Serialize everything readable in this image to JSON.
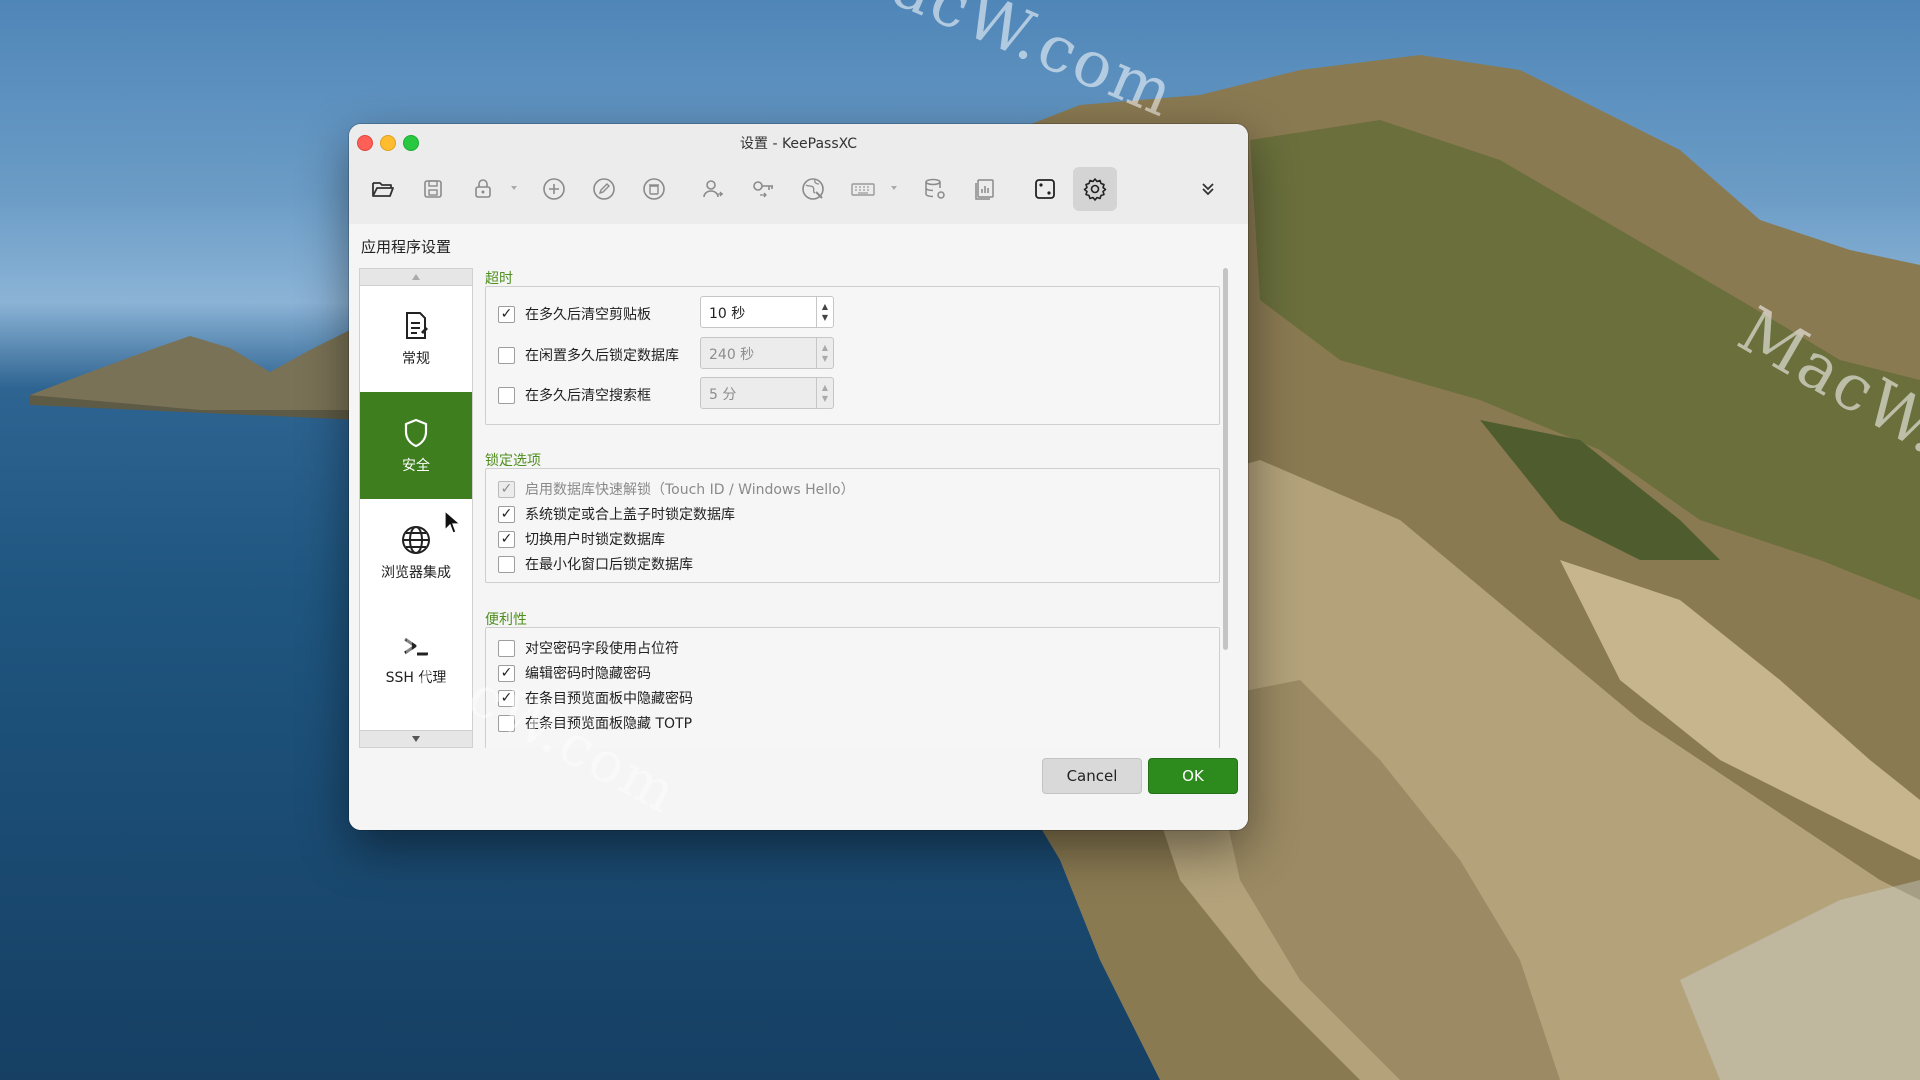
{
  "window": {
    "title": "设置 - KeePassXC"
  },
  "toolbar": {
    "items": [
      {
        "icon": "folder-open-icon"
      },
      {
        "icon": "save-icon"
      },
      {
        "icon": "lock-icon"
      },
      {
        "icon": "add-entry-icon"
      },
      {
        "icon": "edit-entry-icon"
      },
      {
        "icon": "delete-entry-icon"
      },
      {
        "icon": "copy-username-icon"
      },
      {
        "icon": "copy-password-icon"
      },
      {
        "icon": "open-url-icon"
      },
      {
        "icon": "keyboard-autotype-icon"
      },
      {
        "icon": "database-settings-icon"
      },
      {
        "icon": "reports-icon"
      },
      {
        "icon": "password-generator-icon"
      },
      {
        "icon": "settings-gear-icon",
        "active": true
      },
      {
        "icon": "overflow-chevron-icon"
      }
    ]
  },
  "page": {
    "heading": "应用程序设置"
  },
  "sidebar": {
    "items": [
      {
        "label": "常规",
        "icon": "general-document-icon"
      },
      {
        "label": "安全",
        "icon": "shield-icon",
        "active": true
      },
      {
        "label": "浏览器集成",
        "icon": "globe-icon"
      },
      {
        "label": "SSH 代理",
        "icon": "terminal-prompt-icon"
      }
    ]
  },
  "sections": {
    "timeout": {
      "title": "超时",
      "rows": [
        {
          "label": "在多久后清空剪贴板",
          "checked": true,
          "value": "10 秒",
          "enabled": true
        },
        {
          "label": "在闲置多久后锁定数据库",
          "checked": false,
          "value": "240 秒",
          "enabled": false
        },
        {
          "label": "在多久后清空搜索框",
          "checked": false,
          "value": "5 分",
          "enabled": false
        }
      ]
    },
    "lock": {
      "title": "锁定选项",
      "rows": [
        {
          "label": "启用数据库快速解锁（Touch ID / Windows Hello）",
          "checked": true,
          "enabled": false
        },
        {
          "label": "系统锁定或合上盖子时锁定数据库",
          "checked": true,
          "enabled": true
        },
        {
          "label": "切换用户时锁定数据库",
          "checked": true,
          "enabled": true
        },
        {
          "label": "在最小化窗口后锁定数据库",
          "checked": false,
          "enabled": true
        }
      ]
    },
    "convenience": {
      "title": "便利性",
      "rows": [
        {
          "label": "对空密码字段使用占位符",
          "checked": false
        },
        {
          "label": "编辑密码时隐藏密码",
          "checked": true
        },
        {
          "label": "在条目预览面板中隐藏密码",
          "checked": true
        },
        {
          "label": "在条目预览面板隐藏 TOTP",
          "checked": false
        }
      ]
    }
  },
  "buttons": {
    "cancel": "Cancel",
    "ok": "OK"
  },
  "colors": {
    "accent": "#3e7e1e",
    "ok_button": "#2d8a1d",
    "section_title": "#4f8f1f"
  },
  "watermark": "MacW.com"
}
